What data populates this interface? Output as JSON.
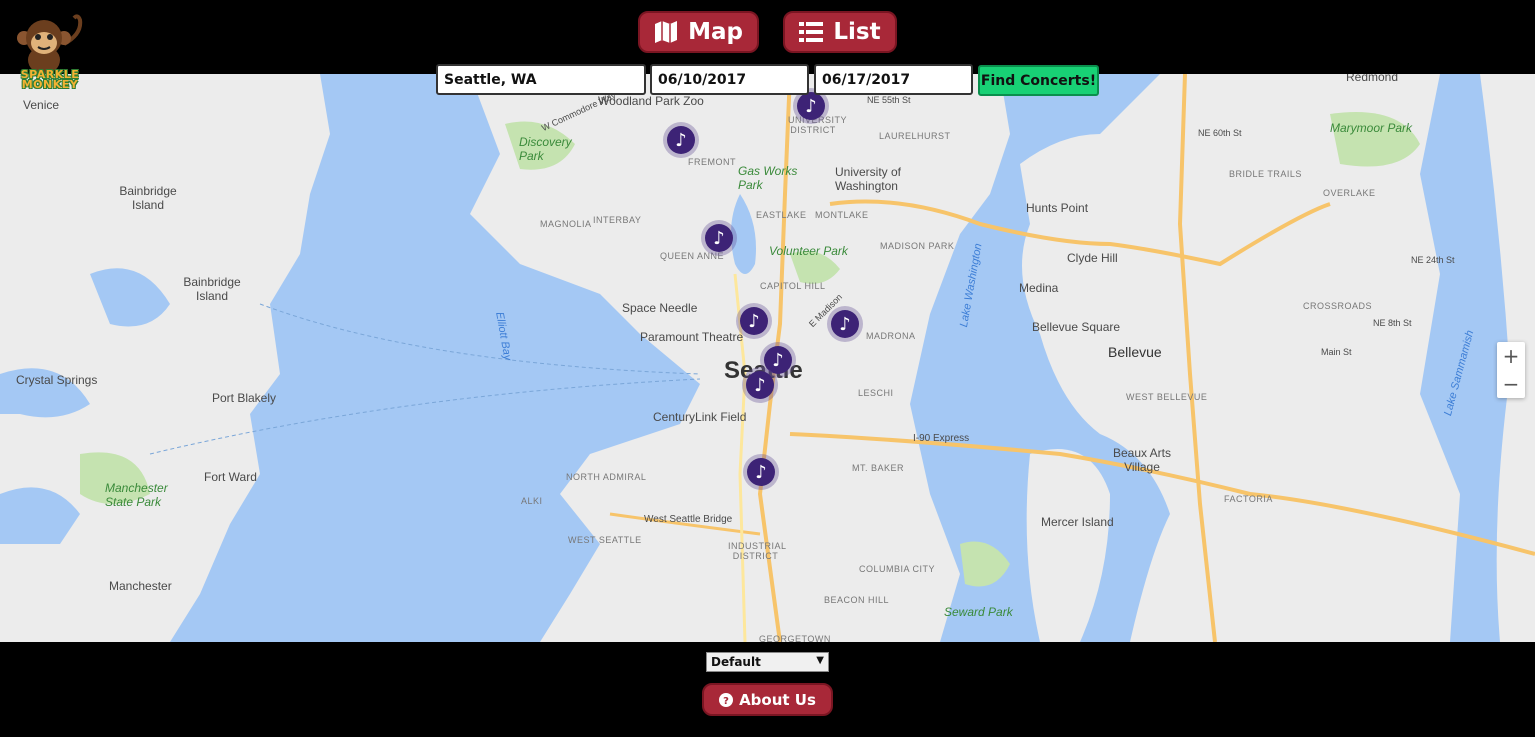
{
  "logo": {
    "text": "SPARKLE MONKEY"
  },
  "nav": {
    "map_label": "Map",
    "list_label": "List"
  },
  "search": {
    "location_value": "Seattle, WA",
    "start_date_value": "06/10/2017",
    "end_date_value": "06/17/2017",
    "find_label": "Find Concerts!"
  },
  "map": {
    "labels": {
      "seattle": "Seattle",
      "bellevue": "Bellevue",
      "discovery_park": "Discovery Park",
      "gas_works_park": "Gas Works Park",
      "university_of_washington": "University of Washington",
      "volunteer_park": "Volunteer Park",
      "space_needle": "Space Needle",
      "paramount_theatre": "Paramount Theatre",
      "centurylink_field": "CenturyLink Field",
      "woodland_park_zoo": "Woodland Park Zoo",
      "bainbridge_island_1": "Bainbridge Island",
      "bainbridge_island_2": "Bainbridge Island",
      "crystal_springs": "Crystal Springs",
      "port_blakely": "Port Blakely",
      "fort_ward": "Fort Ward",
      "manchester_state_park": "Manchester State Park",
      "manchester": "Manchester",
      "medina": "Medina",
      "clyde_hill": "Clyde Hill",
      "hunts_point": "Hunts Point",
      "bellevue_square": "Bellevue Square",
      "beaux_arts_village": "Beaux Arts Village",
      "mercer_island": "Mercer Island",
      "marymoor_park": "Marymoor Park",
      "redmond": "Redmond",
      "seward_park": "Seward Park",
      "venice": "Venice",
      "elliott_bay": "Elliott Bay",
      "lake_washington": "Lake Washington",
      "lake_sammamish": "Lake Sammamish",
      "west_seattle_bridge": "West Seattle Bridge",
      "i90_express": "I-90 Express",
      "fremont": "FREMONT",
      "university_district": "UNIVERSITY DISTRICT",
      "laurelhurst": "LAURELHURST",
      "eastlake": "EASTLAKE",
      "montlake": "MONTLAKE",
      "madison_park": "MADISON PARK",
      "capitol_hill": "CAPITOL HILL",
      "madrona": "MADRONA",
      "leschi": "LESCHI",
      "queen_anne": "QUEEN ANNE",
      "magnolia": "MAGNOLIA",
      "interbay": "INTERBAY",
      "mt_baker": "MT. BAKER",
      "north_admiral": "NORTH ADMIRAL",
      "alki": "ALKI",
      "west_seattle": "WEST SEATTLE",
      "industrial_district": "INDUSTRIAL DISTRICT",
      "columbia_city": "COLUMBIA CITY",
      "beacon_hill": "BEACON HILL",
      "georgetown": "GEORGETOWN",
      "west_bellevue": "WEST BELLEVUE",
      "factoria": "FACTORIA",
      "crossroads": "CROSSROADS",
      "overlake": "OVERLAKE",
      "bridle_trails": "BRIDLE TRAILS",
      "ne_55th_st": "NE 55th St",
      "ne_60th_st": "NE 60th St",
      "ne_24th_st": "NE 24th St",
      "ne_8th_st": "NE 8th St",
      "main_st": "Main St",
      "e_madison": "E Madison",
      "w_commodore_way": "W Commodore Way"
    },
    "zoom_in": "+",
    "zoom_out": "−"
  },
  "filter": {
    "selected": "Default"
  },
  "about": {
    "label": "About Us"
  }
}
